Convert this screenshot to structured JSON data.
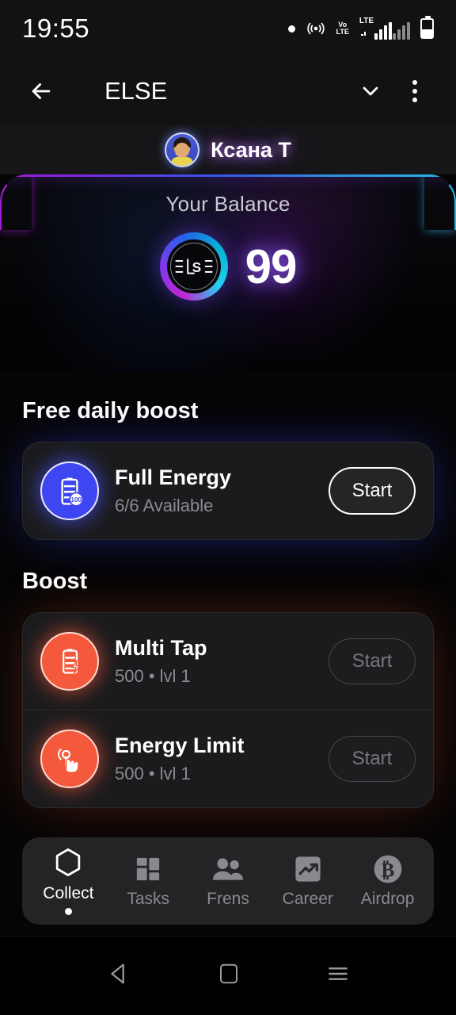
{
  "statusbar": {
    "time": "19:55",
    "icons": [
      "dot-indicator",
      "hotspot-icon",
      "volte-icon",
      "lte-icon",
      "signal-bars-sim1",
      "signal-bars-sim2",
      "battery-icon"
    ],
    "volte_label_top": "Vo",
    "volte_label_bottom": "LTE",
    "lte_label": "LTE"
  },
  "appbar": {
    "back_icon": "arrow-left-icon",
    "title": "ELSE",
    "chevron_icon": "chevron-down-icon",
    "menu_icon": "kebab-menu-icon"
  },
  "user": {
    "name": "Ксана Т",
    "avatar": "user-avatar"
  },
  "balance": {
    "label": "Your Balance",
    "value": "99",
    "coin_symbol": "ELSE",
    "gradient_start": "#a11ad6",
    "gradient_mid": "#3a52e8",
    "gradient_end": "#29b6e8"
  },
  "free_boost": {
    "title": "Free daily boost",
    "items": [
      {
        "name": "Full Energy",
        "subtitle": "6/6 Available",
        "icon": "battery-100-icon",
        "icon_color": "#3d46f0",
        "button": "Start",
        "enabled": true
      }
    ]
  },
  "boost": {
    "title": "Boost",
    "items": [
      {
        "name": "Multi Tap",
        "subtitle": "500 • lvl 1",
        "icon": "battery-bolt-icon",
        "icon_color": "#f4593c",
        "button": "Start",
        "enabled": false
      },
      {
        "name": "Energy Limit",
        "subtitle": "500 • lvl 1",
        "icon": "tap-hand-icon",
        "icon_color": "#f4593c",
        "button": "Start",
        "enabled": false
      }
    ]
  },
  "bottom_nav": {
    "items": [
      {
        "label": "Collect",
        "icon": "hexagon-icon",
        "active": true
      },
      {
        "label": "Tasks",
        "icon": "grid-icon",
        "active": false
      },
      {
        "label": "Frens",
        "icon": "people-icon",
        "active": false
      },
      {
        "label": "Career",
        "icon": "trending-up-icon",
        "active": false
      },
      {
        "label": "Airdrop",
        "icon": "bitcoin-icon",
        "active": false
      }
    ]
  },
  "android_nav": {
    "back_icon": "android-back-icon",
    "home_icon": "android-home-icon",
    "recents_icon": "android-recents-icon"
  }
}
